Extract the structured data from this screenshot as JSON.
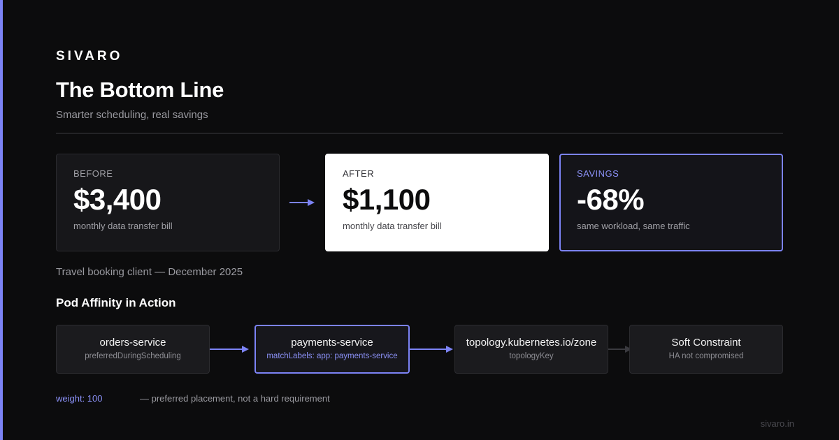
{
  "brand": "SIVARO",
  "title": "The Bottom Line",
  "subtitle": "Smarter scheduling, real savings",
  "colors": {
    "accent": "#7c83f5",
    "background": "#0c0c0d"
  },
  "cards": [
    {
      "label": "BEFORE",
      "value": "$3,400",
      "sub": "monthly data transfer bill"
    },
    {
      "label": "AFTER",
      "value": "$1,100",
      "sub": "monthly data transfer bill"
    },
    {
      "label": "SAVINGS",
      "value": "-68%",
      "sub": "same workload, same traffic"
    }
  ],
  "caption": "Travel booking client — December 2025",
  "section_title": "Pod Affinity in Action",
  "flow": [
    {
      "name": "orders-service",
      "sub": "preferredDuringScheduling"
    },
    {
      "name": "payments-service",
      "sub": "matchLabels: app: payments-service"
    },
    {
      "name": "topology.kubernetes.io/zone",
      "sub": "topologyKey"
    },
    {
      "name": "Soft Constraint",
      "sub": "HA not compromised"
    }
  ],
  "weight_label": "weight: 100",
  "weight_note": "— preferred placement, not a hard requirement",
  "footer": "sivaro.in"
}
